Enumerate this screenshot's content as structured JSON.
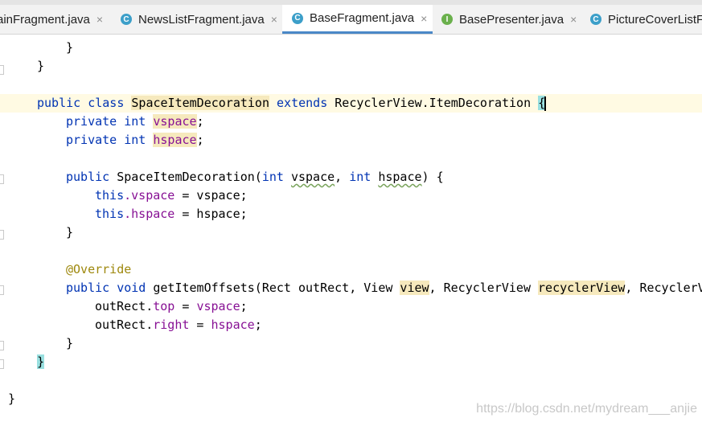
{
  "tabs": [
    {
      "label": "ainFragment.java",
      "icon": "class-icon",
      "active": false
    },
    {
      "label": "NewsListFragment.java",
      "icon": "class-icon",
      "active": false
    },
    {
      "label": "BaseFragment.java",
      "icon": "class-icon",
      "active": true
    },
    {
      "label": "BasePresenter.java",
      "icon": "interface-icon",
      "active": false
    },
    {
      "label": "PictureCoverListFr",
      "icon": "class-icon",
      "active": false
    }
  ],
  "tab_icon_letters": {
    "class": "C",
    "interface": "I"
  },
  "close_glyph": "×",
  "code": {
    "l1": "}",
    "l2": "}",
    "l3_public": "public",
    "l3_class": "class",
    "l3_name": "SpaceItemDecoration",
    "l3_extends": "extends",
    "l3_super": "RecyclerView.ItemDecoration",
    "l3_brace": "{",
    "l4_private": "private",
    "l4_int": "int",
    "l4_field": "vspace",
    "semi": ";",
    "l5_private": "private",
    "l5_int": "int",
    "l5_field": "hspace",
    "l6_public": "public",
    "l6_name": "SpaceItemDecoration(",
    "l6_int1": "int",
    "l6_p1": "vspace",
    "l6_comma": ", ",
    "l6_int2": "int",
    "l6_p2": "hspace",
    "l6_end": ") {",
    "l7_this": "this",
    "l7_field": ".vspace",
    "l7_rest": " = vspace;",
    "l8_this": "this",
    "l8_field": ".hspace",
    "l8_rest": " = hspace;",
    "l9": "}",
    "l10_ann": "@Override",
    "l11_public": "public",
    "l11_void": "void",
    "l11_sig1": "getItemOffsets(Rect outRect, View ",
    "l11_view": "view",
    "l11_sig2": ", RecyclerView ",
    "l11_rv": "recyclerView",
    "l11_sig3": ", RecyclerV",
    "l12_obj": "outRect.",
    "l12_field": "top",
    "l12_eq": " = ",
    "l12_val": "vspace",
    "l13_obj": "outRect.",
    "l13_field": "right",
    "l13_eq": " = ",
    "l13_val": "hspace",
    "l14": "}",
    "l15": "}",
    "l16": "}"
  },
  "watermark": "https://blog.csdn.net/mydream___anjie"
}
